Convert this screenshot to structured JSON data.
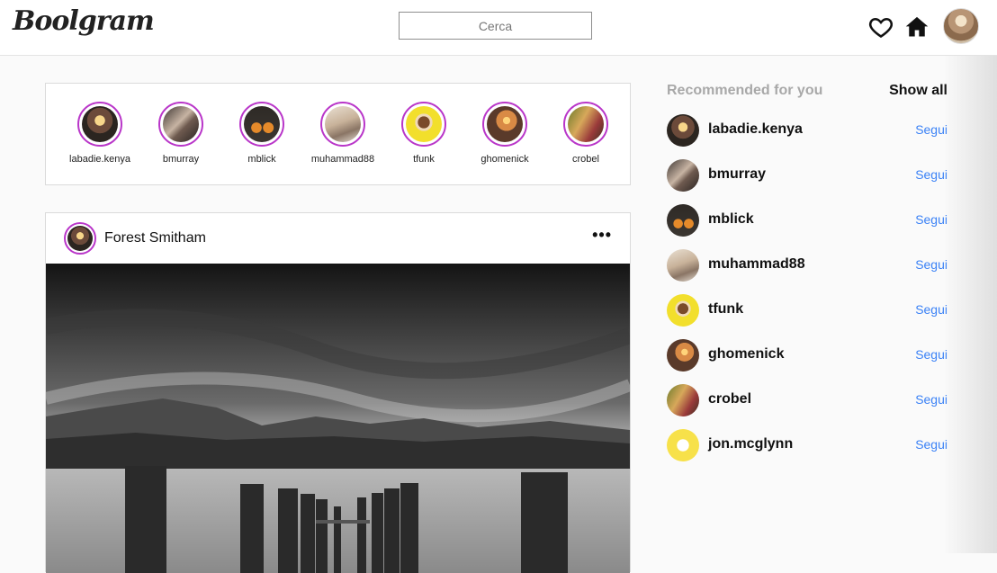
{
  "header": {
    "logo": "Boolgram",
    "search_placeholder": "Cerca",
    "icons": [
      "heart-icon",
      "home-icon"
    ],
    "profile_avatar": "user-avatar"
  },
  "stories": [
    {
      "name": "labadie.kenya"
    },
    {
      "name": "bmurray"
    },
    {
      "name": "mblick"
    },
    {
      "name": "muhammad88"
    },
    {
      "name": "tfunk"
    },
    {
      "name": "ghomenick"
    },
    {
      "name": "crobel"
    }
  ],
  "post": {
    "author": "Forest Smitham",
    "more_label": "•••"
  },
  "recommended": {
    "title": "Recommended for you",
    "show_all": "Show all",
    "follow_label": "Segui",
    "users": [
      {
        "name": "labadie.kenya"
      },
      {
        "name": "bmurray"
      },
      {
        "name": "mblick"
      },
      {
        "name": "muhammad88"
      },
      {
        "name": "tfunk"
      },
      {
        "name": "ghomenick"
      },
      {
        "name": "crobel"
      },
      {
        "name": "jon.mcglynn"
      }
    ]
  },
  "colors": {
    "story_ring": "#b936c9",
    "follow_link": "#3b82f6",
    "muted_title": "#a8a8a8"
  }
}
